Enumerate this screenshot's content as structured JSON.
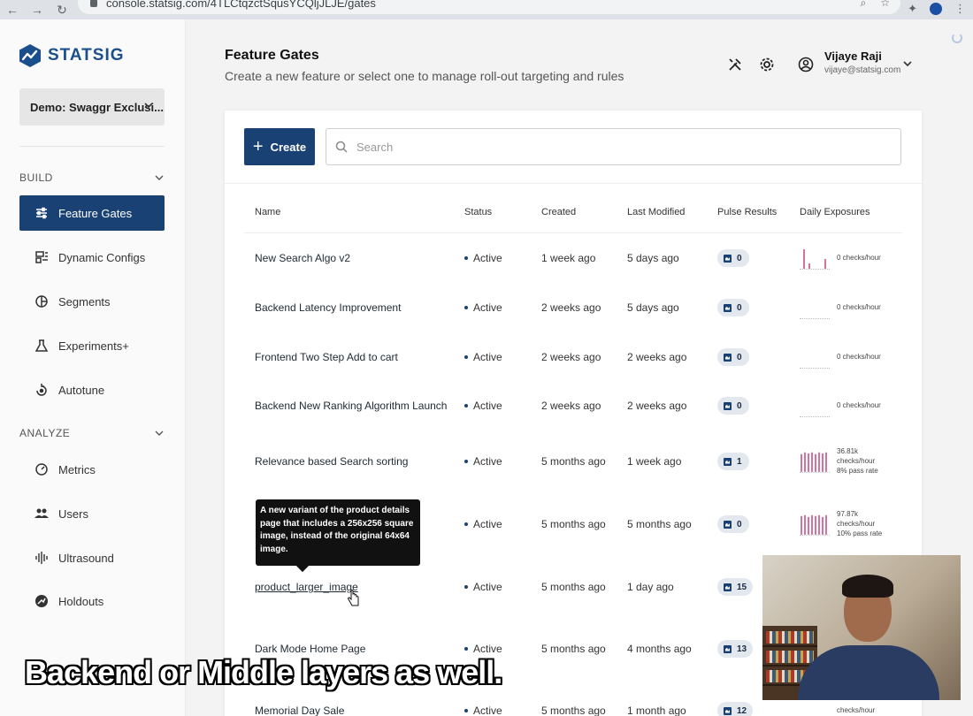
{
  "browser": {
    "url": "console.statsig.com/4TLCtqzctSqusYCQljJLJE/gates"
  },
  "sidebar": {
    "logo_text": "STATSIG",
    "project": "Demo: Swaggr Exclusi...",
    "build_label": "BUILD",
    "analyze_label": "ANALYZE",
    "build_items": [
      {
        "label": "Feature Gates",
        "icon": "sliders-icon",
        "active": true
      },
      {
        "label": "Dynamic Configs",
        "icon": "config-icon"
      },
      {
        "label": "Segments",
        "icon": "segments-icon"
      },
      {
        "label": "Experiments+",
        "icon": "flask-icon"
      },
      {
        "label": "Autotune",
        "icon": "autotune-icon"
      }
    ],
    "analyze_items": [
      {
        "label": "Metrics",
        "icon": "gauge-icon"
      },
      {
        "label": "Users",
        "icon": "users-icon"
      },
      {
        "label": "Ultrasound",
        "icon": "waveform-icon"
      },
      {
        "label": "Holdouts",
        "icon": "holdout-icon"
      }
    ]
  },
  "header": {
    "title": "Feature Gates",
    "subtitle": "Create a new feature or select one to manage roll-out targeting and rules",
    "user_name": "Vijaye Raji",
    "user_email": "vijaye@statsig.com"
  },
  "toolbar": {
    "create_label": "Create",
    "search_placeholder": "Search"
  },
  "table": {
    "columns": [
      "Name",
      "Status",
      "Created",
      "Last Modified",
      "Pulse Results",
      "Daily Exposures"
    ],
    "rows": [
      {
        "name": "New Search Algo v2",
        "status": "Active",
        "created": "1 week ago",
        "modified": "5 days ago",
        "pulse": "0",
        "exposure": [
          "0 checks/hour"
        ]
      },
      {
        "name": "Backend Latency Improvement",
        "status": "Active",
        "created": "2 weeks ago",
        "modified": "5 days ago",
        "pulse": "0",
        "exposure": [
          "0 checks/hour"
        ]
      },
      {
        "name": "Frontend Two Step Add to cart",
        "status": "Active",
        "created": "2 weeks ago",
        "modified": "2 weeks ago",
        "pulse": "0",
        "exposure": [
          "0 checks/hour"
        ]
      },
      {
        "name": "Backend New Ranking Algorithm Launch",
        "status": "Active",
        "created": "2 weeks ago",
        "modified": "2 weeks ago",
        "pulse": "0",
        "exposure": [
          "0 checks/hour"
        ]
      },
      {
        "name": "Relevance based Search sorting",
        "status": "Active",
        "created": "5 months ago",
        "modified": "1 week ago",
        "pulse": "1",
        "exposure": [
          "36.81k",
          "checks/hour",
          "8% pass rate"
        ]
      },
      {
        "name": "",
        "status": "Active",
        "created": "5 months ago",
        "modified": "5 months ago",
        "pulse": "0",
        "exposure": [
          "97.87k",
          "checks/hour",
          "10% pass rate"
        ]
      },
      {
        "name": "product_larger_image",
        "status": "Active",
        "created": "5 months ago",
        "modified": "1 day ago",
        "pulse": "15",
        "exposure": []
      },
      {
        "name": "Dark Mode Home Page",
        "status": "Active",
        "created": "5 months ago",
        "modified": "4 months ago",
        "pulse": "13",
        "exposure": []
      },
      {
        "name": "Memorial Day Sale",
        "status": "Active",
        "created": "5 months ago",
        "modified": "1 month ago",
        "pulse": "12",
        "exposure": [
          "checks/hour"
        ]
      }
    ]
  },
  "tooltip": {
    "text": "A new variant of the product details page that includes a 256x256 square image, instead of the original 64x64 image."
  },
  "caption": {
    "text": "Backend or Middle layers as well."
  },
  "colors": {
    "brand": "#1a4174",
    "spark": "#d6739a"
  }
}
